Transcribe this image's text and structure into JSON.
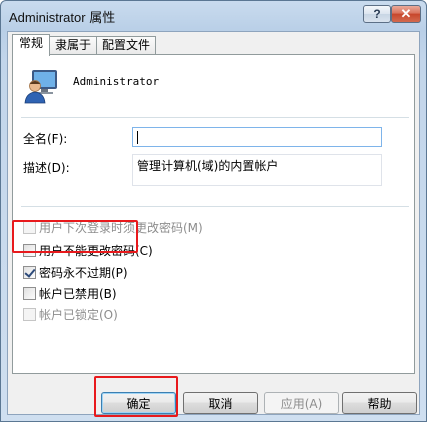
{
  "window": {
    "title": "Administrator 属性",
    "help_label": "?",
    "close_label": "✕"
  },
  "tabs": [
    {
      "label": "常规",
      "active": true
    },
    {
      "label": "隶属于",
      "active": false
    },
    {
      "label": "配置文件",
      "active": false
    }
  ],
  "general": {
    "user_name": "Administrator",
    "full_name_label": "全名(F):",
    "full_name_value": "",
    "description_label": "描述(D):",
    "description_value": "管理计算机(域)的内置帐户"
  },
  "options": [
    {
      "label": "用户下次登录时须更改密码(M)",
      "checked": false,
      "disabled": true
    },
    {
      "label": "用户不能更改密码(C)",
      "checked": false,
      "disabled": false
    },
    {
      "label": "密码永不过期(P)",
      "checked": true,
      "disabled": false
    },
    {
      "label": "帐户已禁用(B)",
      "checked": false,
      "disabled": false
    },
    {
      "label": "帐户已锁定(O)",
      "checked": false,
      "disabled": true
    }
  ],
  "buttons": {
    "ok": "确定",
    "cancel": "取消",
    "apply": "应用(A)",
    "help": "帮助"
  },
  "colors": {
    "highlight": "#e8191c",
    "accent": "#3c7fb1"
  }
}
